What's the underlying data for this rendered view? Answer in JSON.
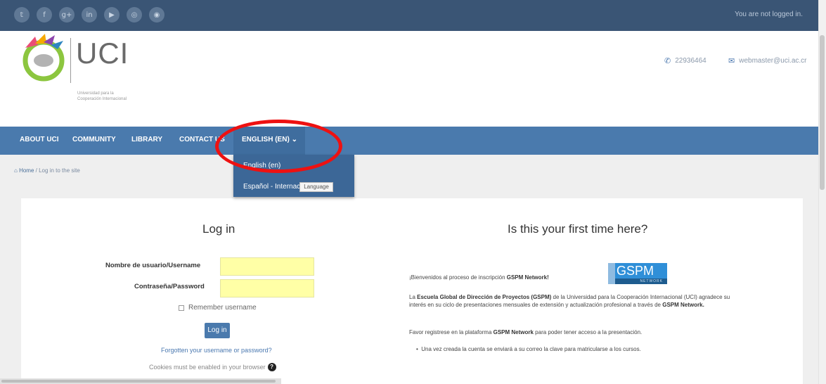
{
  "topbar": {
    "social_icons": [
      {
        "name": "twitter-icon",
        "glyph": "𝕥"
      },
      {
        "name": "facebook-icon",
        "glyph": "f"
      },
      {
        "name": "google-plus-icon",
        "glyph": "g+"
      },
      {
        "name": "linkedin-icon",
        "glyph": "in"
      },
      {
        "name": "youtube-icon",
        "glyph": "▶"
      },
      {
        "name": "instagram-icon",
        "glyph": "◎"
      },
      {
        "name": "rss-icon",
        "glyph": "◉"
      }
    ],
    "login_status": "You are not logged in."
  },
  "header": {
    "logo_title": "UCI",
    "logo_subtitle_1": "Universidad para la",
    "logo_subtitle_2": "Cooperación Internacional",
    "phone": "22936464",
    "email": "webmaster@uci.ac.cr"
  },
  "nav": {
    "items": [
      "ABOUT UCI",
      "COMMUNITY",
      "LIBRARY",
      "CONTACT US"
    ],
    "language": "ENGLISH (EN)"
  },
  "language_dropdown": {
    "items": [
      "English (en)",
      "Español - Internacional (es)"
    ],
    "badge": "Language"
  },
  "breadcrumb": {
    "home": "Home",
    "current": "Log in to the site"
  },
  "login": {
    "title": "Log in",
    "username_label": "Nombre de usuario/Username",
    "password_label": "Contraseña/Password",
    "username_value": "",
    "password_value": "",
    "remember_label": "Remember username",
    "button": "Log in",
    "forgot_link": "Forgotten your username or password?",
    "cookies_text": "Cookies must be enabled in your browser"
  },
  "first_time": {
    "title": "Is this your first time here?",
    "welcome_prefix": "¡Bienvenidos al proceso de inscripción ",
    "welcome_bold": "GSPM Network!",
    "p1_a": "La ",
    "p1_bold1": "Escuela Global de Dirección de Proyectos (GSPM)",
    "p1_b": " de la Universidad para la Cooperación Internacional (UCI) agradece su interés en su ciclo de presentaciones mensuales de extensión y actualización profesional a través de ",
    "p1_bold2": "GSPM Network.",
    "p2_a": "Favor registrese en la plataforma ",
    "p2_bold": "GSPM Network",
    "p2_b": " para poder tener acceso a la presentación.",
    "bullet": "Una vez creada la cuenta se enviará a su correo la clave para matricularse a los cursos.",
    "gspm_logo": "GSPM",
    "gspm_logo_sub": "NETWORK"
  },
  "colors": {
    "topbar": "#3a5575",
    "navbar": "#4a7aad",
    "field": "#ffffa6",
    "annotation": "#ee1111"
  }
}
